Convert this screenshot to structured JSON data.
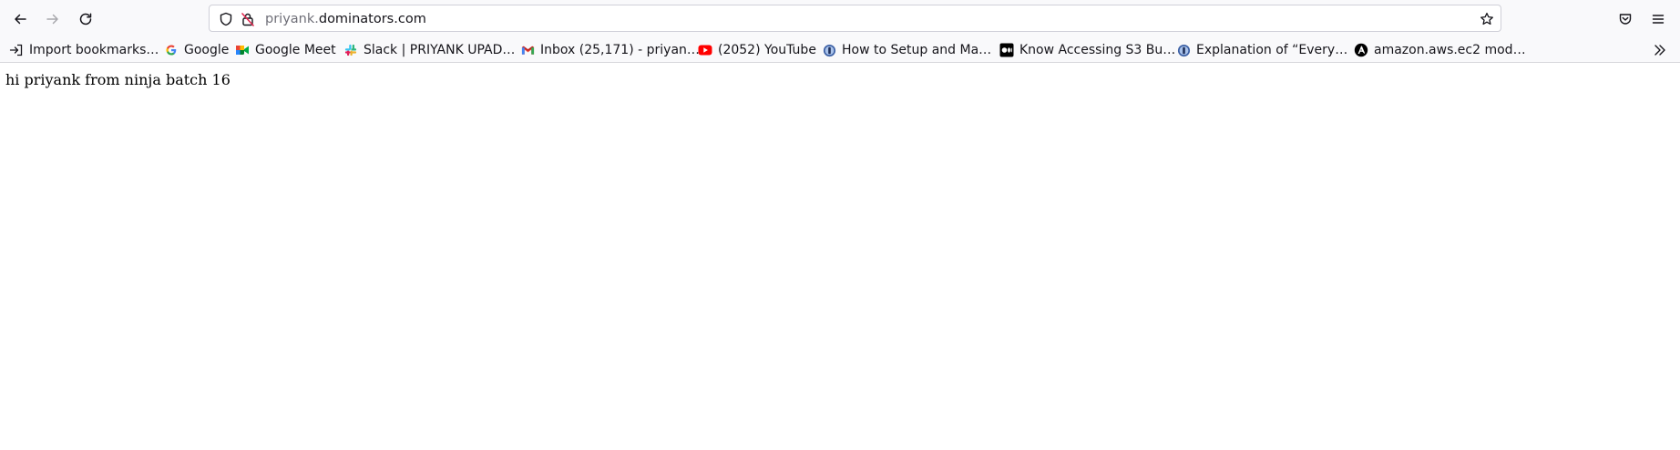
{
  "toolbar": {
    "back_icon": "arrow-left-icon",
    "forward_icon": "arrow-right-icon",
    "reload_icon": "reload-icon",
    "url": {
      "subdomain": "priyank.",
      "domain": "dominators.com"
    },
    "bookmark_star_icon": "star-icon",
    "pocket_icon": "pocket-icon",
    "menu_icon": "hamburger-menu-icon"
  },
  "bookmarks": [
    {
      "label": "Import bookmarks…",
      "icon": "import-icon"
    },
    {
      "label": "Google",
      "icon": "google-icon"
    },
    {
      "label": "Google Meet",
      "icon": "google-meet-icon"
    },
    {
      "label": "Slack | PRIYANK UPAD…",
      "icon": "slack-icon"
    },
    {
      "label": "Inbox (25,171) - priyan…",
      "icon": "gmail-icon"
    },
    {
      "label": "(2052) YouTube",
      "icon": "youtube-icon"
    },
    {
      "label": "How to Setup and Ma…",
      "icon": "blue-circle-icon"
    },
    {
      "label": "Know Accessing S3 Bu…",
      "icon": "medium-icon"
    },
    {
      "label": "Explanation of “Every…",
      "icon": "blue-circle-icon"
    },
    {
      "label": "amazon.aws.ec2 mod…",
      "icon": "ansible-icon"
    }
  ],
  "page": {
    "text": "hi priyank from ninja batch 16"
  },
  "colors": {
    "toolbar_bg": "#f9f9fb",
    "youtube_red": "#ff0000",
    "gmail_red": "#ea4335"
  }
}
